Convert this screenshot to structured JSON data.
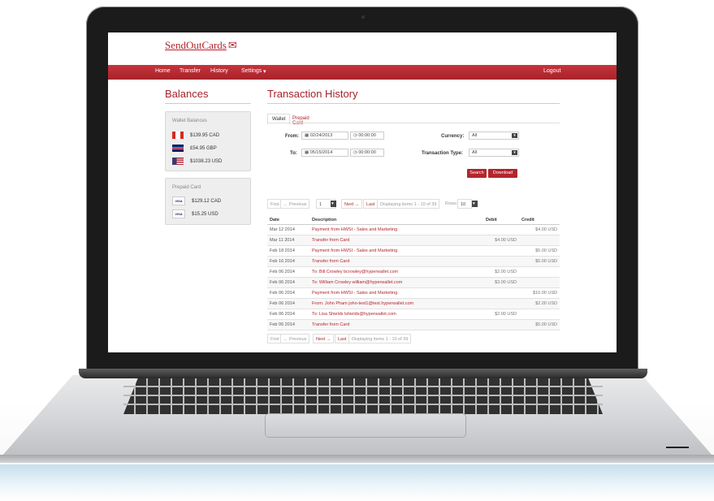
{
  "brand": {
    "logo_text": "SendOutCards"
  },
  "nav": {
    "items": [
      "Home",
      "Transfer",
      "History",
      "Settings"
    ],
    "settings_caret": "▾",
    "logout": "Logout"
  },
  "balances": {
    "heading": "Balances",
    "wallet": {
      "title": "Wallet Balances",
      "items": [
        {
          "amount": "$139.95 CAD",
          "flag": "canada-flag-icon"
        },
        {
          "amount": "£54.95 GBP",
          "flag": "uk-flag-icon"
        },
        {
          "amount": "$1038.23 USD",
          "flag": "us-flag-icon"
        }
      ]
    },
    "prepaid": {
      "title": "Prepaid Card",
      "items": [
        {
          "badge": "VISA",
          "amount": "$129.12 CAD"
        },
        {
          "badge": "VISA",
          "amount": "$15.25 USD"
        }
      ]
    }
  },
  "history": {
    "heading": "Transaction History",
    "tabs": [
      "Wallet",
      "Prepaid Card"
    ],
    "filters": {
      "from_label": "From:",
      "from_date": "02/24/2013",
      "from_time": "00:00:00",
      "to_label": "To:",
      "to_date": "05/15/2014",
      "to_time": "00:00:00",
      "currency_label": "Currency:",
      "currency_value": "All",
      "type_label": "Transaction Type:",
      "type_value": "All"
    },
    "buttons": {
      "search": "Search",
      "download": "Download"
    },
    "pager_top": {
      "first": "First",
      "prev": "← Previous",
      "page": "1",
      "next": "Next →",
      "last": "Last",
      "info": "Displaying items 1 - 10 of 39",
      "rows_label": "Rows:",
      "rows_value": "10"
    },
    "pager_bottom": {
      "first": "First",
      "prev": "← Previous",
      "next": "Next →",
      "last": "Last",
      "info": "Displaying items 1 - 10 of 39"
    },
    "columns": [
      "Date",
      "Description",
      "Debit",
      "Credit"
    ],
    "rows": [
      {
        "date": "Mar 12 2014",
        "desc": "Payment from HWSI - Sales and Marketing",
        "debit": "",
        "credit": "$4.00 USD"
      },
      {
        "date": "Mar 11 2014",
        "desc": "Transfer from Card",
        "debit": "$4.00 USD",
        "credit": ""
      },
      {
        "date": "Feb 18 2014",
        "desc": "Payment from HWSI - Sales and Marketing",
        "debit": "",
        "credit": "$5.00 USD"
      },
      {
        "date": "Feb 16 2014",
        "desc": "Transfer from Card",
        "debit": "",
        "credit": "$5.00 USD"
      },
      {
        "date": "Feb 06 2014",
        "desc": "To: Bill Crowley bcrowley@hyperwallet.com",
        "debit": "$2.00 USD",
        "credit": ""
      },
      {
        "date": "Feb 06 2014",
        "desc": "To: William Crowley william@hyperwallet.com",
        "debit": "$3.00 USD",
        "credit": ""
      },
      {
        "date": "Feb 06 2014",
        "desc": "Payment from HWSI - Sales and Marketing",
        "debit": "",
        "credit": "$10.00 USD"
      },
      {
        "date": "Feb 06 2014",
        "desc": "From: John Pham john-test1@test.hyperwallet.com",
        "debit": "",
        "credit": "$2.00 USD"
      },
      {
        "date": "Feb 06 2014",
        "desc": "To: Lisa Shields lshields@hyperwallet.com",
        "debit": "$2.00 USD",
        "credit": ""
      },
      {
        "date": "Feb 06 2014",
        "desc": "Transfer from Card",
        "debit": "",
        "credit": "$5.00 USD"
      }
    ]
  },
  "colors": {
    "accent": "#b3252c",
    "nav_top": "#c9333a",
    "nav_bottom": "#a5232a"
  }
}
